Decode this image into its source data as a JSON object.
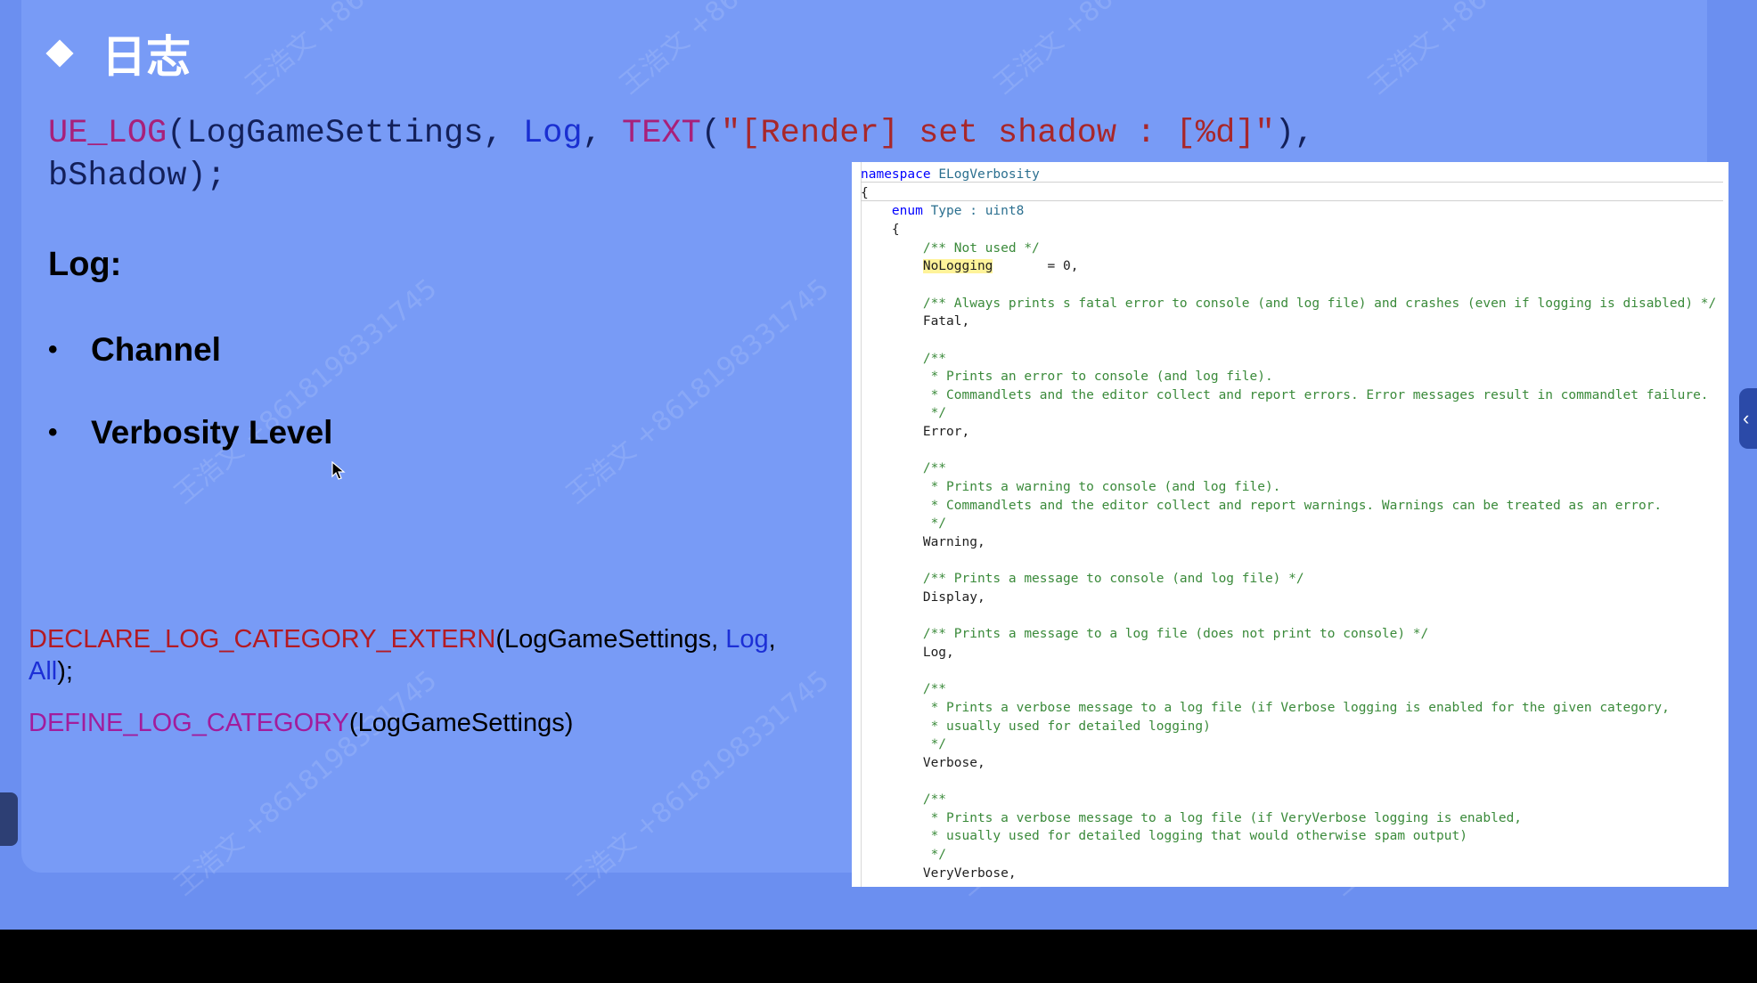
{
  "slide": {
    "title": "日志",
    "ue_log": {
      "macro": "UE_LOG",
      "open": "(",
      "arg1": "LogGameSettings",
      "sep1": ", ",
      "arg2": "Log",
      "sep2": ", ",
      "text_macro": "TEXT",
      "text_open": "(",
      "string": "\"[Render] set shadow : [%d]\"",
      "text_close": "),",
      "line2": "bShadow);"
    },
    "log_heading": "Log:",
    "bullets": [
      "Channel",
      "Verbosity Level"
    ],
    "declare": {
      "macro": "DECLARE_LOG_CATEGORY_EXTERN",
      "open": "(LogGameSettings, ",
      "arg_log": "Log",
      "comma": ",",
      "arg_all": "All",
      "close": ");"
    },
    "define": {
      "macro": "DEFINE_LOG_CATEGORY",
      "args": "(LogGameSettings)"
    },
    "watermark": "王浩文 +8618198331745"
  },
  "code_panel": {
    "lines": [
      [
        {
          "t": "namespace ",
          "c": "kw"
        },
        {
          "t": "ELogVerbosity",
          "c": "type"
        }
      ],
      [
        {
          "t": "{",
          "c": ""
        }
      ],
      [
        {
          "t": "    ",
          "c": ""
        },
        {
          "t": "enum ",
          "c": "kw"
        },
        {
          "t": "Type ",
          "c": "type"
        },
        {
          "t": ": uint8",
          "c": "type"
        }
      ],
      [
        {
          "t": "    {",
          "c": ""
        }
      ],
      [
        {
          "t": "        /** Not used */",
          "c": "cmt"
        }
      ],
      [
        {
          "t": "        ",
          "c": ""
        },
        {
          "t": "NoLogging",
          "c": "hl"
        },
        {
          "t": "       = 0,",
          "c": ""
        }
      ],
      [
        {
          "t": "",
          "c": ""
        }
      ],
      [
        {
          "t": "        /** Always prints s fatal error to console (and log file) and crashes (even if logging is disabled) */",
          "c": "cmt"
        }
      ],
      [
        {
          "t": "        Fatal,",
          "c": ""
        }
      ],
      [
        {
          "t": "",
          "c": ""
        }
      ],
      [
        {
          "t": "        /**",
          "c": "cmt"
        }
      ],
      [
        {
          "t": "         * Prints an error to console (and log file).",
          "c": "cmt"
        }
      ],
      [
        {
          "t": "         * Commandlets and the editor collect and report errors. Error messages result in commandlet failure.",
          "c": "cmt"
        }
      ],
      [
        {
          "t": "         */",
          "c": "cmt"
        }
      ],
      [
        {
          "t": "        Error,",
          "c": ""
        }
      ],
      [
        {
          "t": "",
          "c": ""
        }
      ],
      [
        {
          "t": "        /**",
          "c": "cmt"
        }
      ],
      [
        {
          "t": "         * Prints a warning to console (and log file).",
          "c": "cmt"
        }
      ],
      [
        {
          "t": "         * Commandlets and the editor collect and report warnings. Warnings can be treated as an error.",
          "c": "cmt"
        }
      ],
      [
        {
          "t": "         */",
          "c": "cmt"
        }
      ],
      [
        {
          "t": "        Warning,",
          "c": ""
        }
      ],
      [
        {
          "t": "",
          "c": ""
        }
      ],
      [
        {
          "t": "        /** Prints a message to console (and log file) */",
          "c": "cmt"
        }
      ],
      [
        {
          "t": "        Display,",
          "c": ""
        }
      ],
      [
        {
          "t": "",
          "c": ""
        }
      ],
      [
        {
          "t": "        /** Prints a message to a log file (does not print to console) */",
          "c": "cmt"
        }
      ],
      [
        {
          "t": "        Log,",
          "c": ""
        }
      ],
      [
        {
          "t": "",
          "c": ""
        }
      ],
      [
        {
          "t": "        /**",
          "c": "cmt"
        }
      ],
      [
        {
          "t": "         * Prints a verbose message to a log file (if Verbose logging is enabled for the given category,",
          "c": "cmt"
        }
      ],
      [
        {
          "t": "         * usually used for detailed logging)",
          "c": "cmt"
        }
      ],
      [
        {
          "t": "         */",
          "c": "cmt"
        }
      ],
      [
        {
          "t": "        Verbose,",
          "c": ""
        }
      ],
      [
        {
          "t": "",
          "c": ""
        }
      ],
      [
        {
          "t": "        /**",
          "c": "cmt"
        }
      ],
      [
        {
          "t": "         * Prints a verbose message to a log file (if VeryVerbose logging is enabled,",
          "c": "cmt"
        }
      ],
      [
        {
          "t": "         * usually used for detailed logging that would otherwise spam output)",
          "c": "cmt"
        }
      ],
      [
        {
          "t": "         */",
          "c": "cmt"
        }
      ],
      [
        {
          "t": "        VeryVerbose,",
          "c": ""
        }
      ]
    ]
  },
  "side_tab_icon": "‹",
  "colors": {
    "stage": "#6b8ff0",
    "slide": "#789bf6",
    "macro": "#a8207a",
    "blue": "#1a2fd1",
    "string": "#a8272a",
    "comment": "#3a8a3a"
  }
}
